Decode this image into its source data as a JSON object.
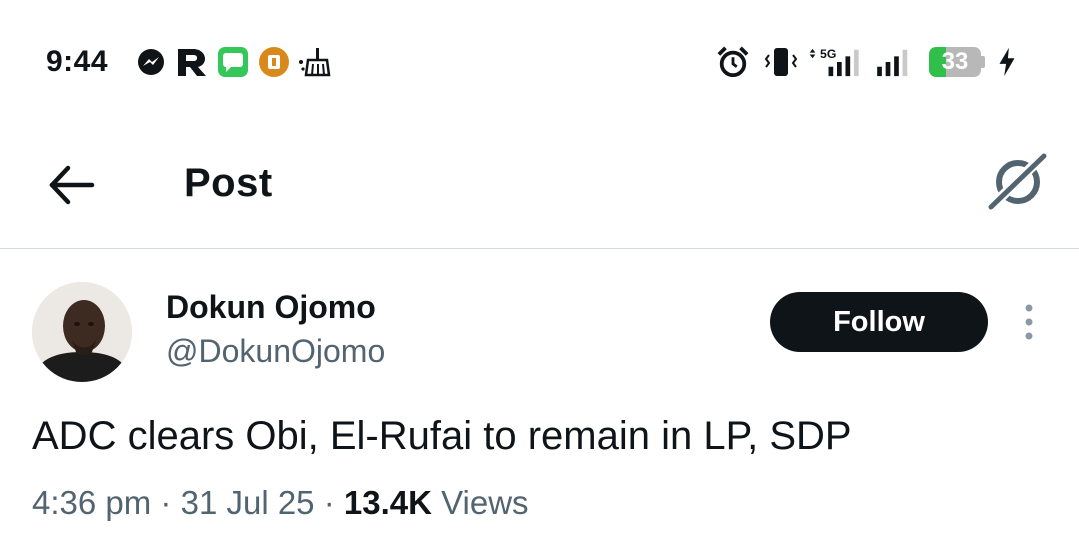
{
  "status_bar": {
    "time": "9:44",
    "battery_level_percent": 33,
    "battery_text": "33",
    "network_label": "5G",
    "notification_icons": [
      "messenger-icon",
      "r-app-icon",
      "messages-icon",
      "honey-app-icon",
      "cleaner-icon"
    ],
    "system_icons": [
      "alarm-icon",
      "vibrate-icon",
      "signal-5g-icon",
      "signal-icon",
      "battery-icon",
      "charging-icon"
    ]
  },
  "header": {
    "title": "Post",
    "back_icon": "arrow-left-icon",
    "grok_icon": "grok-icon"
  },
  "post": {
    "author_name": "Dokun Ojomo",
    "author_handle": "@DokunOjomo",
    "follow_label": "Follow",
    "more_icon": "more-vertical-icon",
    "text": "ADC clears Obi, El-Rufai to remain in LP, SDP",
    "time": "4:36 pm",
    "separator": "·",
    "date": "31 Jul 25",
    "views_count": "13.4K",
    "views_label": "Views"
  },
  "colors": {
    "text_primary": "#0f1419",
    "text_secondary": "#536471",
    "follow_bg": "#0f1419",
    "divider": "#cfd9de",
    "battery_green": "#2fbf4a"
  }
}
